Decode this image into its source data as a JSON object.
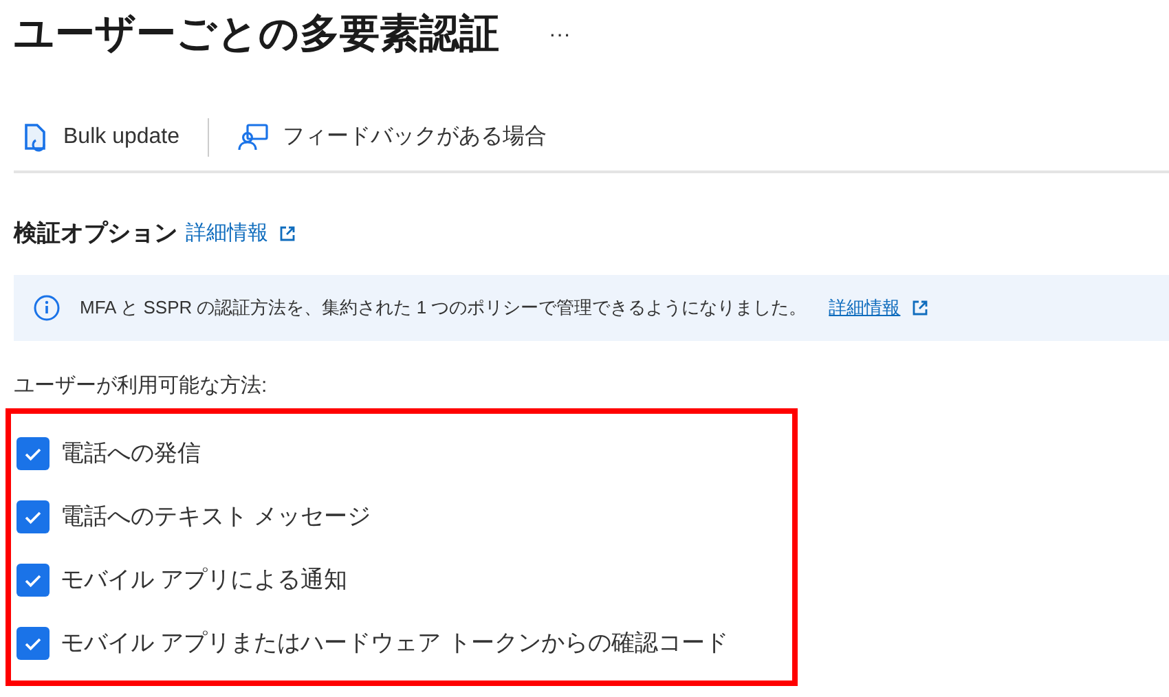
{
  "title": "ユーザーごとの多要素認証",
  "more": "···",
  "toolbar": [
    {
      "kind": "bulk",
      "label": "Bulk update"
    },
    {
      "kind": "feedback",
      "label": "フィードバックがある場合"
    }
  ],
  "section": {
    "heading": "検証オプション",
    "link": "詳細情報"
  },
  "info_banner": {
    "message": "MFA と SSPR の認証方法を、集約された 1 つのポリシーで管理できるようになりました。",
    "link": "詳細情報"
  },
  "methods_label": "ユーザーが利用可能な方法:",
  "methods": [
    {
      "label": "電話への発信",
      "checked": true
    },
    {
      "label": "電話へのテキスト メッセージ",
      "checked": true
    },
    {
      "label": "モバイル アプリによる通知",
      "checked": true
    },
    {
      "label": "モバイル アプリまたはハードウェア トークンからの確認コード",
      "checked": true
    }
  ]
}
